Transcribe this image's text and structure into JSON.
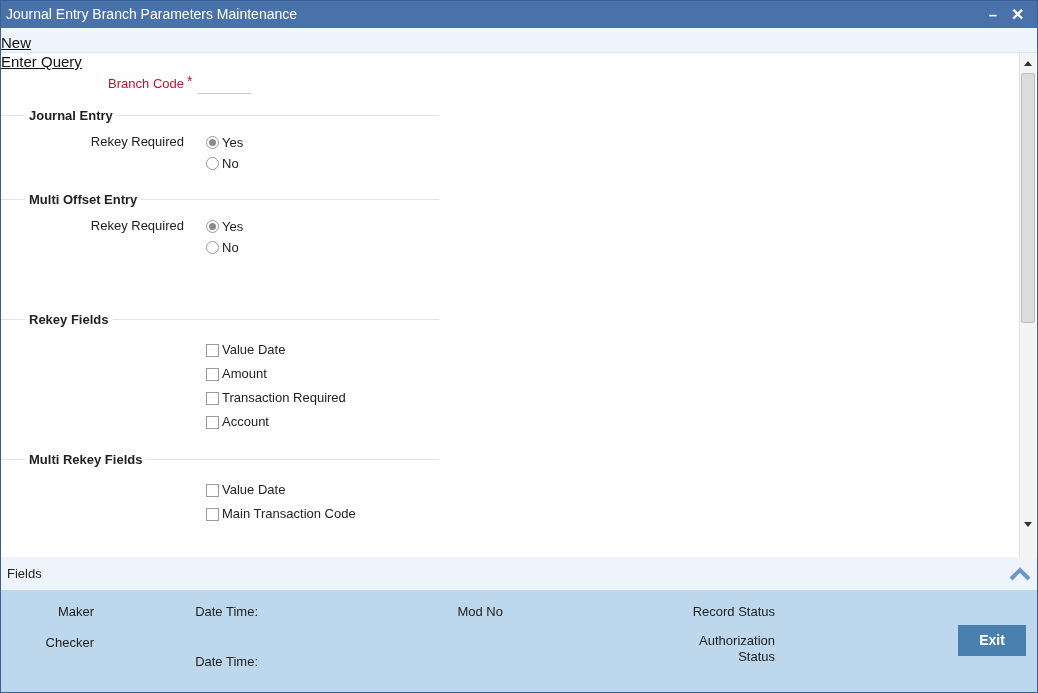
{
  "window": {
    "title": "Journal Entry Branch Parameters Maintenance",
    "buttons": [
      "–",
      "✕"
    ]
  },
  "toolbar": {
    "links": [
      "New",
      "Enter Query"
    ]
  },
  "branch_code": {
    "label": "Branch Code",
    "required_mark": "*"
  },
  "sections": [
    {
      "title": "Journal Entry",
      "kind": "radio",
      "label": "Rekey Required",
      "options": [
        {
          "label": "Yes",
          "selected": true
        },
        {
          "label": "No",
          "selected": false
        }
      ]
    },
    {
      "title": "Multi Offset Entry",
      "kind": "radio",
      "label": "Rekey Required",
      "options": [
        {
          "label": "Yes",
          "selected": true
        },
        {
          "label": "No",
          "selected": false
        }
      ]
    },
    {
      "title": "Rekey Fields",
      "kind": "checkbox",
      "options": [
        {
          "label": "Value Date",
          "checked": false
        },
        {
          "label": "Amount",
          "checked": false
        },
        {
          "label": "Transaction Required",
          "checked": false
        },
        {
          "label": "Account",
          "checked": false
        }
      ]
    },
    {
      "title": "Multi Rekey Fields",
      "kind": "checkbox",
      "options": [
        {
          "label": "Value Date",
          "checked": false
        },
        {
          "label": "Main Transaction Code",
          "checked": false
        }
      ]
    }
  ],
  "fields_bar": {
    "label": "Fields"
  },
  "audit": {
    "maker": "Maker",
    "checker": "Checker",
    "date_time_1": "Date Time:",
    "date_time_2": "Date Time:",
    "mod_no": "Mod No",
    "record_status": "Record Status",
    "authorization_status": "Authorization Status"
  },
  "exit_button": "Exit"
}
